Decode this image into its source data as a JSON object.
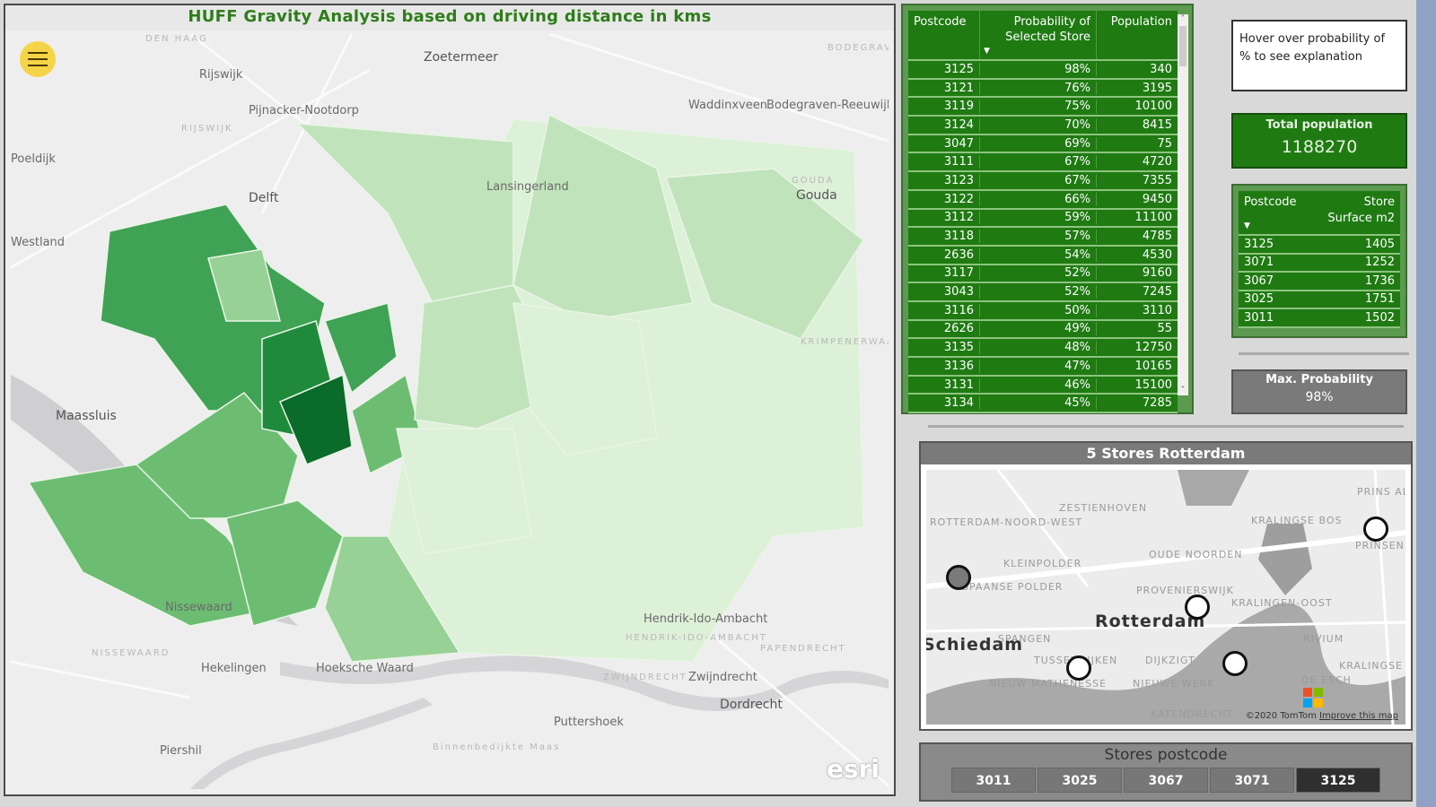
{
  "left_panel": {
    "title": "HUFF Gravity Analysis based on driving distance in kms",
    "menu_icon": "hamburger-menu-icon",
    "map_labels": [
      {
        "text": "DEN HAAG",
        "style": "faint"
      },
      {
        "text": "Zoetermeer",
        "style": "big"
      },
      {
        "text": "Rijswijk",
        "style": "normal"
      },
      {
        "text": "Pijnacker-Nootdorp",
        "style": "normal"
      },
      {
        "text": "RIJSWIJK",
        "style": "faint"
      },
      {
        "text": "Poeldijk",
        "style": "normal"
      },
      {
        "text": "Delft",
        "style": "big"
      },
      {
        "text": "Lansingerland",
        "style": "normal"
      },
      {
        "text": "Waddinxveen",
        "style": "normal"
      },
      {
        "text": "Bodegraven-Reeuwijk",
        "style": "normal"
      },
      {
        "text": "BODEGRAVEN",
        "style": "faint"
      },
      {
        "text": "GOUDA",
        "style": "faint"
      },
      {
        "text": "Gouda",
        "style": "big"
      },
      {
        "text": "Westland",
        "style": "normal"
      },
      {
        "text": "Maassluis",
        "style": "big"
      },
      {
        "text": "KRIMPENERWAARD",
        "style": "faint"
      },
      {
        "text": "Nissewaard",
        "style": "normal"
      },
      {
        "text": "NISSEWAARD",
        "style": "faint"
      },
      {
        "text": "Hekelingen",
        "style": "normal"
      },
      {
        "text": "Hoeksche Waard",
        "style": "normal"
      },
      {
        "text": "Hendrik-Ido-Ambacht",
        "style": "normal"
      },
      {
        "text": "HENDRIK-IDO-AMBACHT",
        "style": "faint"
      },
      {
        "text": "PAPENDRECHT",
        "style": "faint"
      },
      {
        "text": "ZWIJNDRECHT",
        "style": "faint"
      },
      {
        "text": "Zwijndrecht",
        "style": "normal"
      },
      {
        "text": "Dordrecht",
        "style": "big"
      },
      {
        "text": "Puttershoek",
        "style": "normal"
      },
      {
        "text": "Binnenbedijkte Maas",
        "style": "faint"
      },
      {
        "text": "Piershil",
        "style": "normal"
      }
    ],
    "attribution": "esri",
    "choropleth_colors": [
      "#0a6b2a",
      "#1f8a3c",
      "#3fa254",
      "#6cbd72",
      "#98d196",
      "#c1e3bb",
      "#ddf0d8"
    ]
  },
  "probability_table": {
    "columns": [
      "Postcode",
      "Probability of Selected Store",
      "Population"
    ],
    "sort_column": "Probability of Selected Store",
    "sort_direction": "descending",
    "rows": [
      [
        "3125",
        "98%",
        "340"
      ],
      [
        "3121",
        "76%",
        "3195"
      ],
      [
        "3119",
        "75%",
        "10100"
      ],
      [
        "3124",
        "70%",
        "8415"
      ],
      [
        "3047",
        "69%",
        "75"
      ],
      [
        "3111",
        "67%",
        "4720"
      ],
      [
        "3123",
        "67%",
        "7355"
      ],
      [
        "3122",
        "66%",
        "9450"
      ],
      [
        "3112",
        "59%",
        "11100"
      ],
      [
        "3118",
        "57%",
        "4785"
      ],
      [
        "2636",
        "54%",
        "4530"
      ],
      [
        "3117",
        "52%",
        "9160"
      ],
      [
        "3043",
        "52%",
        "7245"
      ],
      [
        "3116",
        "50%",
        "3110"
      ],
      [
        "2626",
        "49%",
        "55"
      ],
      [
        "3135",
        "48%",
        "12750"
      ],
      [
        "3136",
        "47%",
        "10165"
      ],
      [
        "3131",
        "46%",
        "15100"
      ],
      [
        "3134",
        "45%",
        "7285"
      ]
    ]
  },
  "info_box": {
    "text": "Hover over probability of % to see explanation"
  },
  "total_population": {
    "label": "Total population",
    "value": "1188270"
  },
  "store_table": {
    "columns": [
      "Postcode",
      "Store Surface m2"
    ],
    "rows": [
      [
        "3125",
        "1405"
      ],
      [
        "3071",
        "1252"
      ],
      [
        "3067",
        "1736"
      ],
      [
        "3025",
        "1751"
      ],
      [
        "3011",
        "1502"
      ]
    ]
  },
  "max_probability": {
    "label": "Max. Probability",
    "value": "98%"
  },
  "stores_map": {
    "title": "5 Stores Rotterdam",
    "labels": [
      "ZESTIENHOVEN",
      "ROTTERDAM-NOORD-WEST",
      "KLEINPOLDER",
      "SPAANSE POLDER",
      "OUDE NOORDEN",
      "KRALINGSE BOS",
      "PRINS ALEXANDER",
      "PRINSENLAND",
      "PROVENIERSWIJK",
      "KRALINGEN-OOST",
      "SPANGEN",
      "TUSSENDIJKEN",
      "DIJKZIGT",
      "NIEUWE WERK",
      "NIEUW MATHENESSE",
      "RIVIUM",
      "KRALINGSE",
      "DE ESCH",
      "KATENDRECHT"
    ],
    "city_labels": [
      "Rotterdam",
      "Schiedam"
    ],
    "attribution": "©2020 TomTom",
    "improve_link": "Improve this map"
  },
  "slicer": {
    "title": "Stores postcode",
    "options": [
      "3011",
      "3025",
      "3067",
      "3071",
      "3125"
    ],
    "selected": "3125"
  }
}
